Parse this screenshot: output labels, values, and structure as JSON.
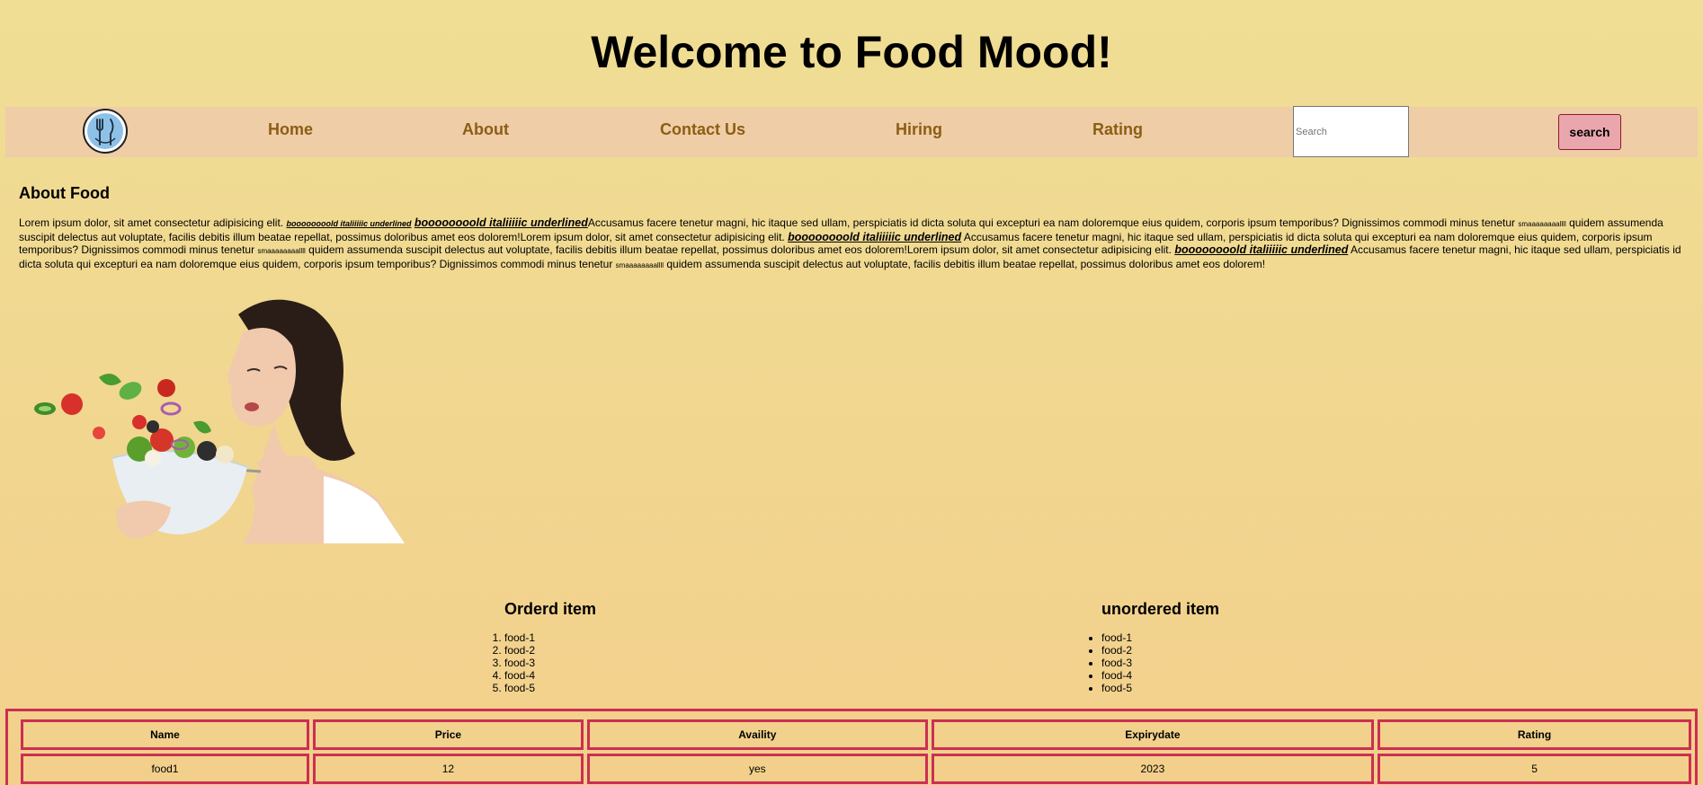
{
  "header": {
    "title": "Welcome to Food Mood!"
  },
  "nav": {
    "links": [
      "Home",
      "About",
      "Contact Us",
      "Hiring",
      "Rating"
    ],
    "search_placeholder": "Search",
    "search_button": "search"
  },
  "about": {
    "heading": "About Food",
    "p1": "Lorem ipsum dolor, sit amet consectetur adipisicing elit. ",
    "bold_small": "boooooooold italiiiiic underlined",
    "bold_big": "boooooooold italiiiiic underlined",
    "p2": "Accusamus facere tenetur magni, hic itaque sed ullam, perspiciatis id dicta soluta qui excepturi ea nam doloremque eius quidem, corporis ipsum temporibus? Dignissimos commodi minus tenetur ",
    "tiny": "smaaaaaaaallll",
    "p3": " quidem assumenda suscipit delectus aut voluptate, facilis debitis illum beatae repellat, possimus doloribus amet eos dolorem!Lorem ipsum dolor, sit amet consectetur adipisicing elit. ",
    "bold_2": "boooooooold italiiiiic underlined",
    "p4": " Accusamus facere tenetur magni, hic itaque sed ullam, perspiciatis id dicta soluta qui excepturi ea nam doloremque eius quidem, corporis ipsum temporibus? Dignissimos commodi minus tenetur ",
    "tiny2": "smaaaaaaaallll",
    "p5": " quidem assumenda suscipit delectus aut voluptate, facilis debitis illum beatae repellat, possimus doloribus amet eos dolorem!Lorem ipsum dolor, sit amet consectetur adipisicing elit. ",
    "bold_3": "boooooooold italiiiiic underlined",
    "p6": " Accusamus facere tenetur magni, hic itaque sed ullam, perspiciatis id dicta soluta qui excepturi ea nam doloremque eius quidem, corporis ipsum temporibus? Dignissimos commodi minus tenetur ",
    "tiny3": "smaaaaaaaallll",
    "p7": " quidem assumenda suscipit delectus aut voluptate, facilis debitis illum beatae repellat, possimus doloribus amet eos dolorem!"
  },
  "ordered": {
    "title": "Orderd item",
    "items": [
      "food-1",
      "food-2",
      "food-3",
      "food-4",
      "food-5"
    ]
  },
  "unordered": {
    "title": "unordered item",
    "items": [
      "food-1",
      "food-2",
      "food-3",
      "food-4",
      "food-5"
    ]
  },
  "table": {
    "headers": [
      "Name",
      "Price",
      "Availity",
      "Expirydate",
      "Rating"
    ],
    "rows": [
      [
        "food1",
        "12",
        "yes",
        "2023",
        "5"
      ]
    ]
  },
  "colors": {
    "nav_link": "#8b5e14",
    "table_border": "#cc2f52",
    "button_bg": "#e9a6ad",
    "navbar_bg": "#efcda7"
  }
}
